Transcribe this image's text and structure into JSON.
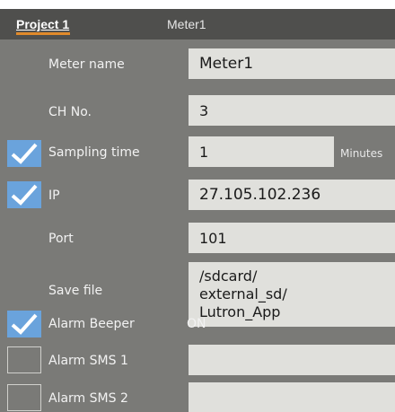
{
  "top_fragment": "",
  "tabs": {
    "active": "Project 1",
    "inactive": "Meter1"
  },
  "rows": {
    "meter_name": {
      "label": "Meter name",
      "value": "Meter1"
    },
    "ch_no": {
      "label": "CH No.",
      "value": "3"
    },
    "sampling_time": {
      "label": "Sampling time",
      "value": "1",
      "unit": "Minutes",
      "checked": true
    },
    "ip": {
      "label": "IP",
      "value": "27.105.102.236",
      "checked": true
    },
    "port": {
      "label": "Port",
      "value": "101"
    },
    "save_file": {
      "label": "Save file",
      "line1": "/sdcard/",
      "line2": "external_sd/",
      "line3": "Lutron_App"
    },
    "alarm_beeper": {
      "label": "Alarm Beeper",
      "value": "ON",
      "checked": true
    },
    "alarm_sms_1": {
      "label": "Alarm SMS 1",
      "value": "",
      "checked": false
    },
    "alarm_sms_2": {
      "label": "Alarm SMS 2",
      "value": "",
      "checked": false
    }
  },
  "colors": {
    "panel": "#7a7a77",
    "tabbar": "#4f4f4d",
    "field": "#e0e0dc",
    "check": "#6aa3dc",
    "tab_underline": "#e08a2a"
  }
}
